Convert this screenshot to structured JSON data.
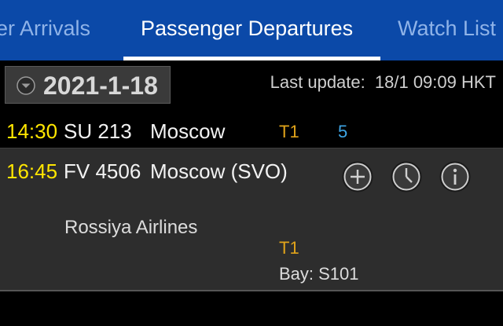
{
  "tabs": {
    "arrivals": "ger Arrivals",
    "departures": "Passenger Departures",
    "watch": "Watch List"
  },
  "date_selector": {
    "date": "2021-1-18",
    "icon": "chevron-down-circle-icon"
  },
  "last_update": {
    "label": "Last update:",
    "value": "18/1 09:09 HKT"
  },
  "flights": [
    {
      "time": "14:30",
      "flight": "SU 213",
      "destination": "Moscow",
      "terminal": "T1",
      "gate": "5"
    },
    {
      "time": "16:45",
      "flight": "FV 4506",
      "destination": "Moscow (SVO)",
      "airline": "Rossiya Airlines",
      "terminal": "T1",
      "bay": "Bay: S101",
      "actions": [
        "add-icon",
        "clock-icon",
        "info-icon"
      ]
    }
  ],
  "colors": {
    "tab_bar": "#0b49a8",
    "time": "#ffe600",
    "terminal": "#e0a31a",
    "gate": "#3ea6e6"
  }
}
